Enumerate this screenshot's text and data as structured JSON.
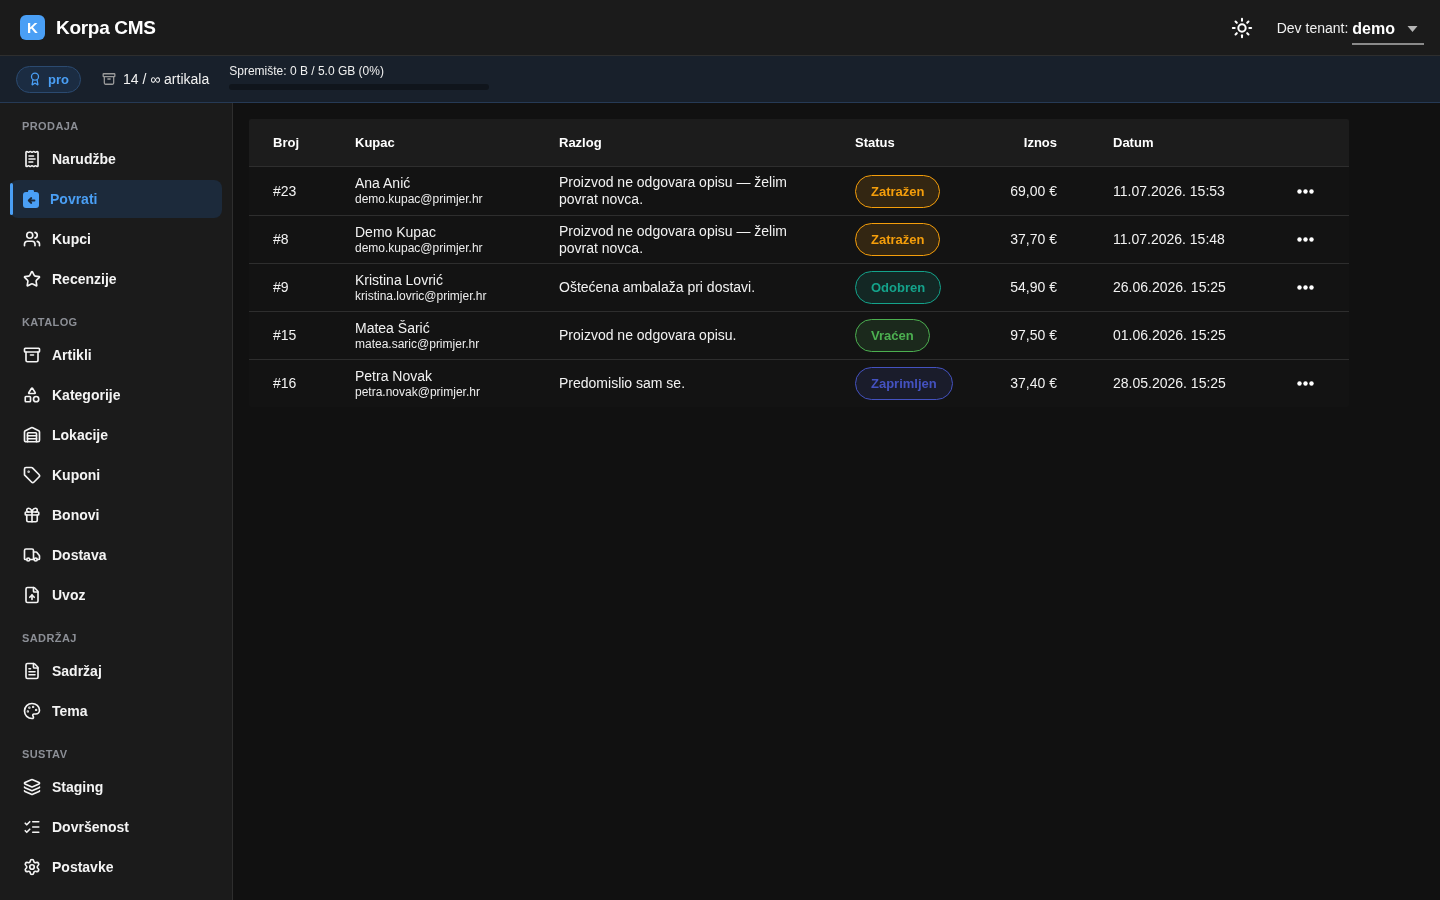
{
  "header": {
    "logo_letter": "K",
    "title": "Korpa CMS",
    "tenant": {
      "label": "Dev tenant:",
      "value": "demo"
    }
  },
  "plan_bar": {
    "plan": "pro",
    "articles": "14 / ∞ artikala",
    "storage": {
      "label": "Spremište: 0 B / 5.0 GB (0%)",
      "level": 0
    }
  },
  "sidebar": {
    "sections": [
      {
        "title": "PRODAJA",
        "items": [
          {
            "label": "Narudžbe",
            "selected": false
          },
          {
            "label": "Povrati",
            "selected": true
          },
          {
            "label": "Kupci",
            "selected": false
          },
          {
            "label": "Recenzije",
            "selected": false
          }
        ]
      },
      {
        "title": "KATALOG",
        "items": [
          {
            "label": "Artikli",
            "selected": false
          },
          {
            "label": "Kategorije",
            "selected": false
          },
          {
            "label": "Lokacije",
            "selected": false
          },
          {
            "label": "Kuponi",
            "selected": false
          },
          {
            "label": "Bonovi",
            "selected": false
          },
          {
            "label": "Dostava",
            "selected": false
          },
          {
            "label": "Uvoz",
            "selected": false
          }
        ]
      },
      {
        "title": "SADRŽAJ",
        "items": [
          {
            "label": "Sadržaj",
            "selected": false
          },
          {
            "label": "Tema",
            "selected": false
          }
        ]
      },
      {
        "title": "SUSTAV",
        "items": [
          {
            "label": "Staging",
            "selected": false
          },
          {
            "label": "Dovršenost",
            "selected": false
          },
          {
            "label": "Postavke",
            "selected": false
          }
        ]
      }
    ]
  },
  "table": {
    "columns": [
      "Broj",
      "Kupac",
      "Razlog",
      "Status",
      "Iznos",
      "Datum"
    ],
    "rows": [
      {
        "number": "#23",
        "customer": "Ana Anić",
        "email": "demo.kupac@primjer.hr",
        "reason": "Proizvod ne odgovara opisu — želim povrat novca.",
        "status": {
          "label": "Zatražen",
          "color": "#f59e0b"
        },
        "amount": "69,00 €",
        "date": "11.07.2026. 15:53",
        "actions": true
      },
      {
        "number": "#8",
        "customer": "Demo Kupac",
        "email": "demo.kupac@primjer.hr",
        "reason": "Proizvod ne odgovara opisu — želim povrat novca.",
        "status": {
          "label": "Zatražen",
          "color": "#f59e0b"
        },
        "amount": "37,70 €",
        "date": "11.07.2026. 15:48",
        "actions": true
      },
      {
        "number": "#9",
        "customer": "Kristina Lovrić",
        "email": "kristina.lovric@primjer.hr",
        "reason": "Oštećena ambalaža pri dostavi.",
        "status": {
          "label": "Odobren",
          "color": "#14a38b"
        },
        "amount": "54,90 €",
        "date": "26.06.2026. 15:25",
        "actions": true
      },
      {
        "number": "#15",
        "customer": "Matea Šarić",
        "email": "matea.saric@primjer.hr",
        "reason": "Proizvod ne odgovara opisu.",
        "status": {
          "label": "Vraćen",
          "color": "#4caf50"
        },
        "amount": "97,50 €",
        "date": "01.06.2026. 15:25",
        "actions": false
      },
      {
        "number": "#16",
        "customer": "Petra Novak",
        "email": "petra.novak@primjer.hr",
        "reason": "Predomislio sam se.",
        "status": {
          "label": "Zaprimljen",
          "color": "#4452c0"
        },
        "amount": "37,40 €",
        "date": "28.05.2026. 15:25",
        "actions": true
      }
    ]
  }
}
